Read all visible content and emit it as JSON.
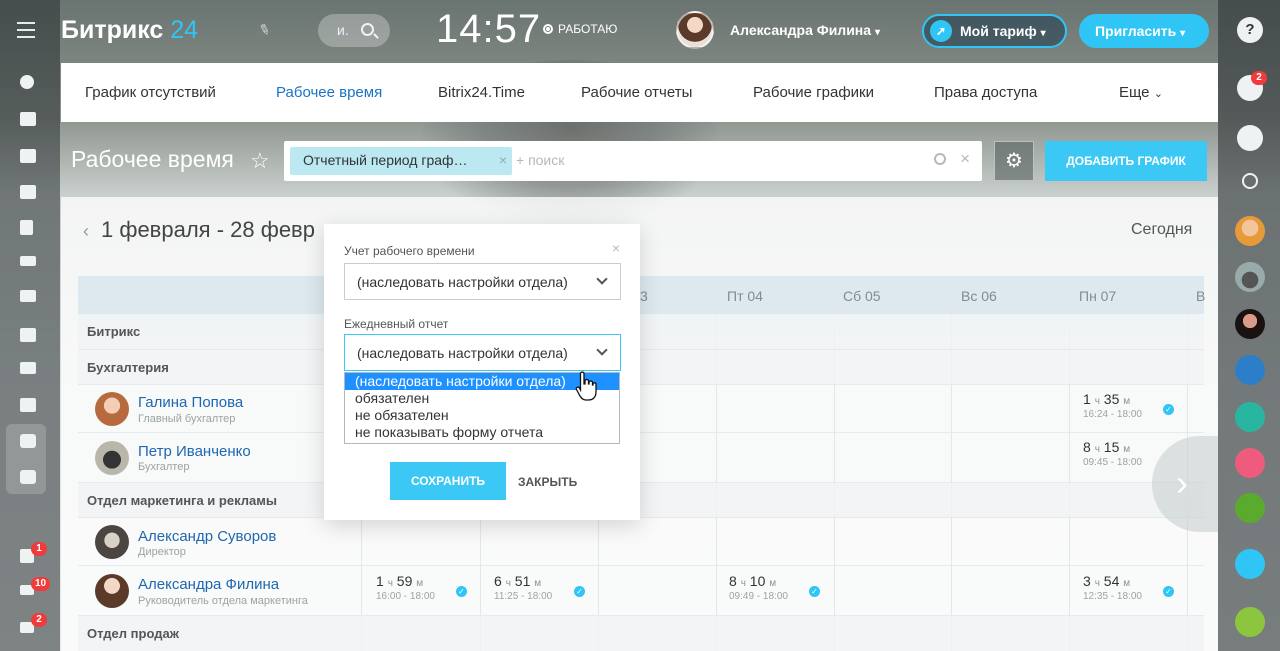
{
  "header": {
    "logo_text": "Битрикс",
    "logo_number": "24",
    "search_text": "и.",
    "time": "14:57",
    "work_status": "РАБОТАЮ",
    "user_name": "Александра Филина",
    "tariff_label": "Мой тариф",
    "invite_label": "Пригласить"
  },
  "tabs": [
    {
      "label": "График отсутствий"
    },
    {
      "label": "Рабочее время"
    },
    {
      "label": "Bitrix24.Time"
    },
    {
      "label": "Рабочие отчеты"
    },
    {
      "label": "Рабочие графики"
    },
    {
      "label": "Права доступа"
    },
    {
      "label": "Еще"
    }
  ],
  "page": {
    "title": "Рабочее время",
    "filter_tag": "Отчетный период граф…",
    "filter_placeholder": "+ поиск",
    "add_button": "ДОБАВИТЬ ГРАФИК",
    "period": "1 февраля - 28 февр",
    "today": "Сегодня"
  },
  "day_headers": [
    "3",
    "Пт 04",
    "Сб 05",
    "Вс 06",
    "Пн 07",
    "В"
  ],
  "sections": {
    "bitrix": "Битрикс",
    "accounting": "Бухгалтерия",
    "marketing": "Отдел маркетинга и рекламы",
    "sales": "Отдел продаж"
  },
  "people": [
    {
      "name": "Галина Попова",
      "position": "Главный бухгалтер"
    },
    {
      "name": "Петр Иванченко",
      "position": "Бухгалтер"
    },
    {
      "name": "Александр Суворов",
      "position": "Директор"
    },
    {
      "name": "Александра Филина",
      "position": "Руководитель отдела маркетинга"
    }
  ],
  "worktimes": {
    "galina_mon": {
      "h": "1",
      "hu": "ч",
      "m": "35",
      "mu": "м",
      "range": "16:24 - 18:00"
    },
    "petr_mon": {
      "h": "8",
      "hu": "ч",
      "m": "15",
      "mu": "м",
      "range": "09:45 - 18:00"
    },
    "af_1": {
      "h": "1",
      "hu": "ч",
      "m": "59",
      "mu": "м",
      "range": "16:00 - 18:00"
    },
    "af_2": {
      "h": "6",
      "hu": "ч",
      "m": "51",
      "mu": "м",
      "range": "11:25 - 18:00"
    },
    "af_3": {
      "h": "8",
      "hu": "ч",
      "m": "10",
      "mu": "м",
      "range": "09:49 - 18:00"
    },
    "af_4": {
      "h": "3",
      "hu": "ч",
      "m": "54",
      "mu": "м",
      "range": "12:35 - 18:00"
    }
  },
  "popup": {
    "label_worktime": "Учет рабочего времени",
    "select_worktime": "(наследовать настройки отдела)",
    "label_report": "Ежедневный отчет",
    "select_report": "(наследовать настройки отдела)",
    "options": [
      "(наследовать настройки отдела)",
      "обязателен",
      "не обязателен",
      "не показывать форму отчета"
    ],
    "save": "СОХРАНИТЬ",
    "close": "ЗАКРЫТЬ"
  },
  "badges": {
    "tasks": "1",
    "feed": "10",
    "mail": "2",
    "notifications": "2"
  },
  "colors": {
    "accent": "#2fc6f6",
    "link": "#1f67b0",
    "active_tab": "#1a73c8",
    "select_highlight": "#1e90ff"
  }
}
